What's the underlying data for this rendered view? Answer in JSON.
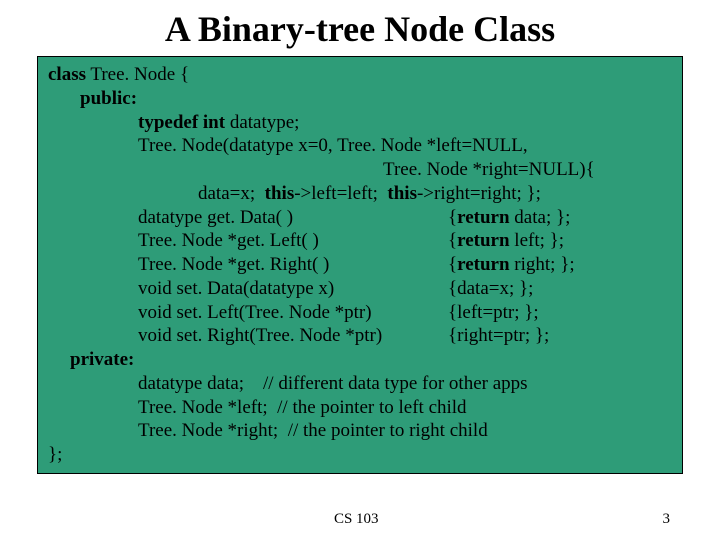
{
  "title": "A Binary-tree Node Class",
  "code": {
    "l1a": "class",
    "l1b": " Tree. Node {",
    "l2": "public:",
    "l3a": "typedef int",
    "l3b": " datatype;",
    "l4": "Tree. Node(datatype x=0, Tree. Node *left=NULL,",
    "l5": "Tree. Node *right=NULL){",
    "l6a": "data=x;  ",
    "l6b": "this",
    "l6c": "->left=left;  ",
    "l6d": "this",
    "l6e": "->right=right; };",
    "l7L": "datatype get. Data( )",
    "l7Ra": "{",
    "l7Rb": "return",
    "l7Rc": " data; };",
    "l8L": "Tree. Node *get. Left( )",
    "l8Ra": "{",
    "l8Rb": "return",
    "l8Rc": " left; };",
    "l9L": "Tree. Node *get. Right( )",
    "l9Ra": "{",
    "l9Rb": "return",
    "l9Rc": " right; };",
    "l10L": "void set. Data(datatype x)",
    "l10R": "{data=x; };",
    "l11L": "void set. Left(Tree. Node *ptr)",
    "l11R": "{left=ptr; };",
    "l12L": "void set. Right(Tree. Node *ptr)",
    "l12R": "{right=ptr; };",
    "l13": "private:",
    "l14": "datatype data;    // different data type for other apps",
    "l15": "Tree. Node *left;  // the pointer to left child",
    "l16": "Tree. Node *right;  // the pointer to right child",
    "l17": "};"
  },
  "footer": {
    "course": "CS 103",
    "page": "3"
  }
}
